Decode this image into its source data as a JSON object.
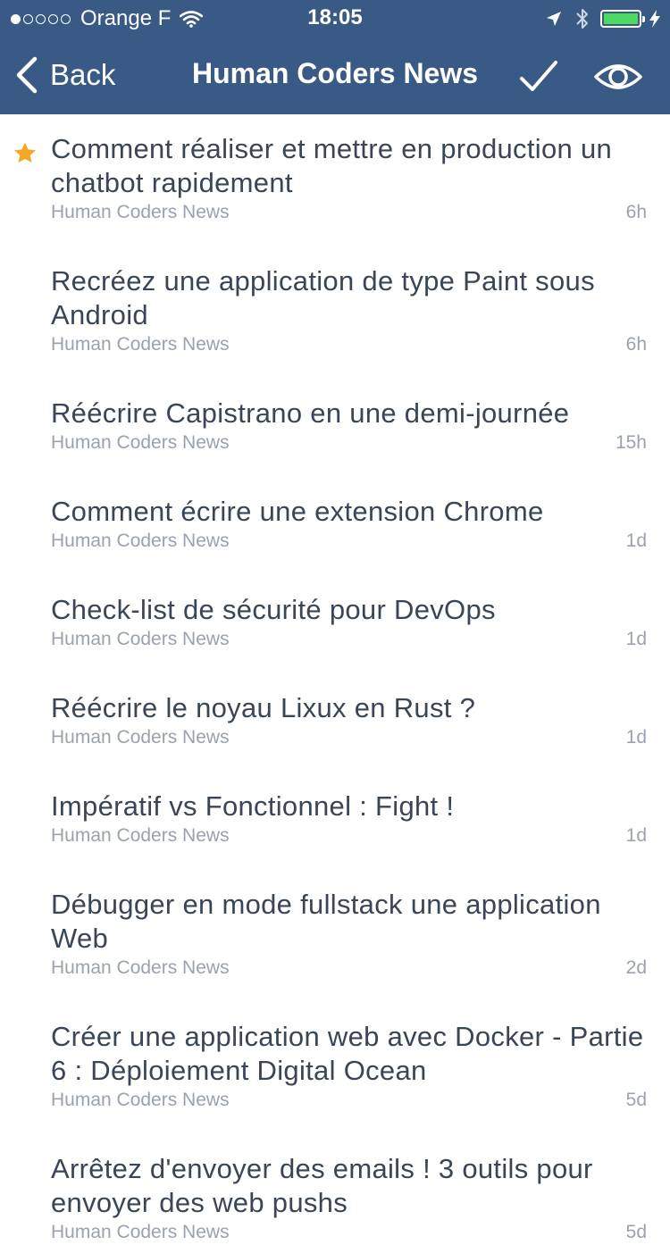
{
  "status_bar": {
    "carrier": "Orange F",
    "time": "18:05",
    "signal_bars_filled": 1,
    "signal_bars_total": 5,
    "battery_level": 1.0,
    "battery_color": "#4cd964",
    "icons": [
      "wifi-icon",
      "location-arrow-icon",
      "bluetooth-icon",
      "battery-icon",
      "charging-bolt-icon"
    ]
  },
  "nav": {
    "back_label": "Back",
    "title": "Human Coders News",
    "background_color": "#3a5a86",
    "icons": [
      "back-chevron-icon",
      "checkmark-icon",
      "eye-icon"
    ]
  },
  "articles": [
    {
      "title": "Comment réaliser et mettre en production un chatbot rapidement",
      "source": "Human Coders News",
      "age": "6h",
      "starred": true
    },
    {
      "title": "Recréez une application de type Paint sous Android",
      "source": "Human Coders News",
      "age": "6h",
      "starred": false
    },
    {
      "title": "Réécrire Capistrano en une demi-journée",
      "source": "Human Coders News",
      "age": "15h",
      "starred": false
    },
    {
      "title": "Comment écrire une extension Chrome",
      "source": "Human Coders News",
      "age": "1d",
      "starred": false
    },
    {
      "title": "Check-list de sécurité pour DevOps",
      "source": "Human Coders News",
      "age": "1d",
      "starred": false
    },
    {
      "title": "Réécrire le noyau Lixux en Rust ?",
      "source": "Human Coders News",
      "age": "1d",
      "starred": false
    },
    {
      "title": "Impératif vs Fonctionnel : Fight !",
      "source": "Human Coders News",
      "age": "1d",
      "starred": false
    },
    {
      "title": "Débugger en mode fullstack une application Web",
      "source": "Human Coders News",
      "age": "2d",
      "starred": false
    },
    {
      "title": "Créer une application web avec Docker - Partie 6 : Déploiement Digital Ocean",
      "source": "Human Coders News",
      "age": "5d",
      "starred": false
    },
    {
      "title": "Arrêtez d'envoyer des emails ! 3 outils pour envoyer des web pushs",
      "source": "Human Coders News",
      "age": "5d",
      "starred": false
    }
  ],
  "star_color": "#f5a623"
}
